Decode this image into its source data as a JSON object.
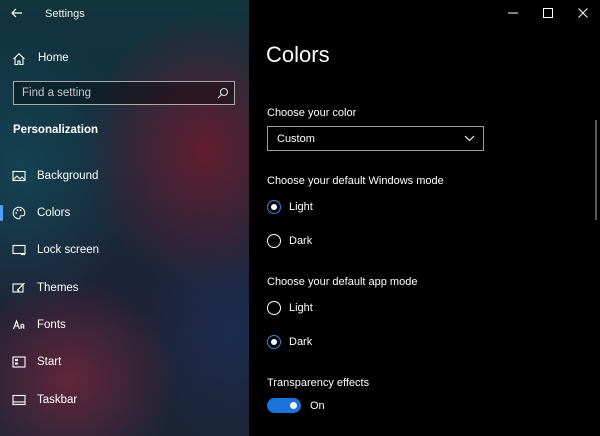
{
  "window": {
    "title": "Settings"
  },
  "sidebar": {
    "home_label": "Home",
    "search_placeholder": "Find a setting",
    "section_title": "Personalization",
    "items": [
      {
        "label": "Background",
        "icon": "picture-icon"
      },
      {
        "label": "Colors",
        "icon": "palette-icon",
        "selected": true
      },
      {
        "label": "Lock screen",
        "icon": "lock-screen-icon"
      },
      {
        "label": "Themes",
        "icon": "themes-icon"
      },
      {
        "label": "Fonts",
        "icon": "fonts-icon"
      },
      {
        "label": "Start",
        "icon": "start-icon"
      },
      {
        "label": "Taskbar",
        "icon": "taskbar-icon"
      }
    ]
  },
  "main": {
    "title": "Colors",
    "choose_color": {
      "label": "Choose your color",
      "value": "Custom"
    },
    "windows_mode": {
      "label": "Choose your default Windows mode",
      "options": [
        {
          "label": "Light",
          "checked": true
        },
        {
          "label": "Dark",
          "checked": false
        }
      ]
    },
    "app_mode": {
      "label": "Choose your default app mode",
      "options": [
        {
          "label": "Light",
          "checked": false
        },
        {
          "label": "Dark",
          "checked": true
        }
      ]
    },
    "transparency": {
      "label": "Transparency effects",
      "state": "On"
    }
  },
  "colors": {
    "accent": "#1a73d9",
    "selection_bar": "#4da3ff",
    "main_background": "#000000"
  }
}
